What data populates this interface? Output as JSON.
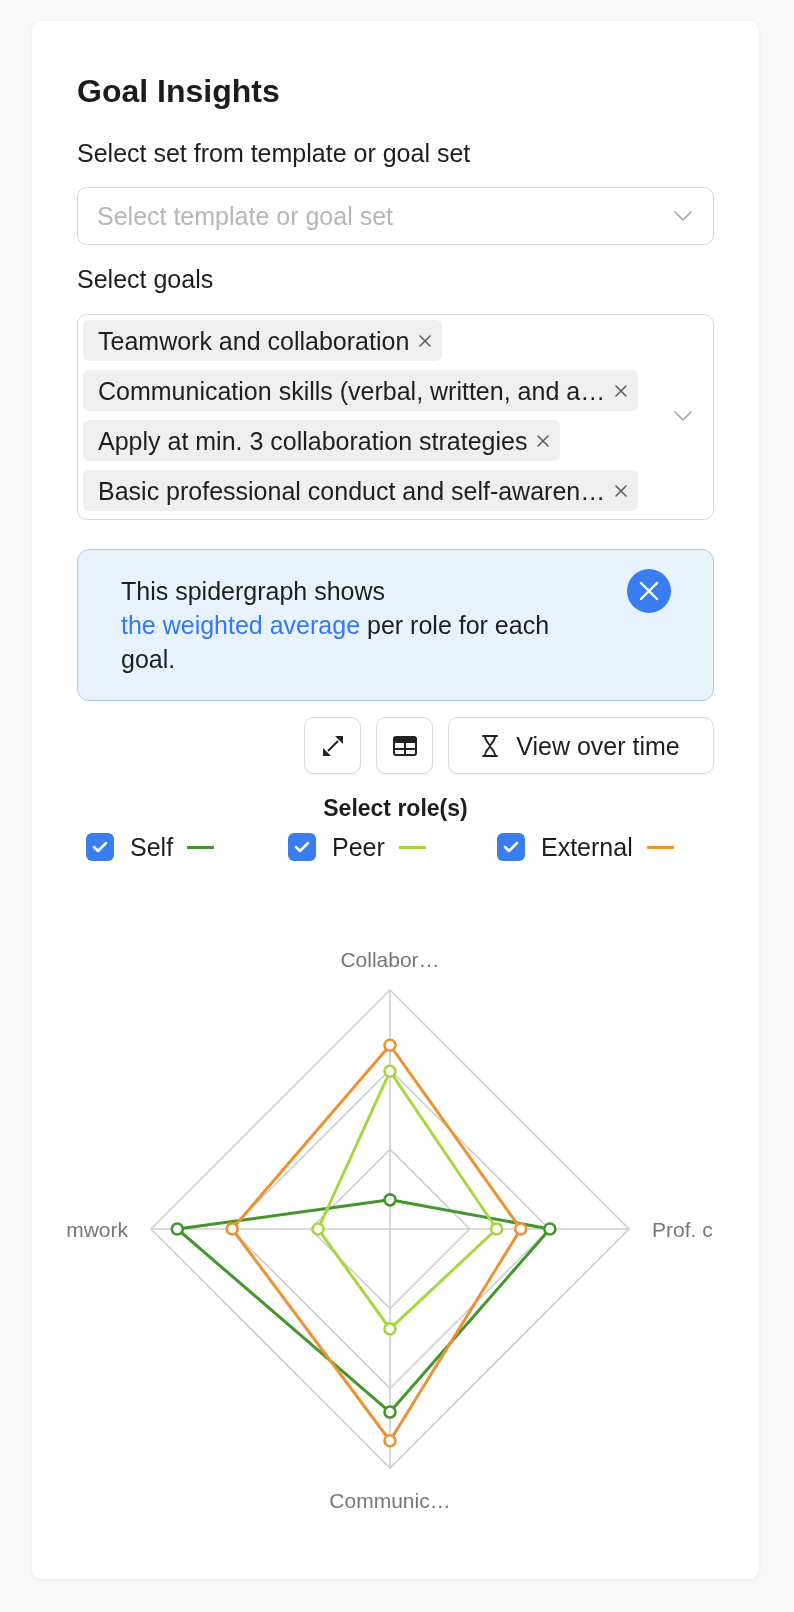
{
  "title": "Goal Insights",
  "template_field": {
    "label": "Select set from template or goal set",
    "placeholder": "Select template or goal set"
  },
  "goals_field": {
    "label": "Select goals",
    "chips": [
      "Teamwork and collaboration",
      "Communication skills (verbal, written, and a…",
      "Apply at min. 3 collaboration strategies",
      "Basic professional conduct and self-awaren…"
    ]
  },
  "info": {
    "text_before": "This spidergraph shows",
    "link": "the weighted average",
    "text_after": "per role for each goal."
  },
  "view_over_time_button": "View over time",
  "roles": {
    "heading": "Select role(s)",
    "items": [
      {
        "name": "Self",
        "checked": true,
        "color": "#41972b"
      },
      {
        "name": "Peer",
        "checked": true,
        "color": "#a8d63f"
      },
      {
        "name": "External",
        "checked": true,
        "color": "#ec9233"
      }
    ]
  },
  "chart": {
    "axis_labels": [
      "Collabor…",
      "Prof. c",
      "Communic…",
      "mwork"
    ]
  }
}
